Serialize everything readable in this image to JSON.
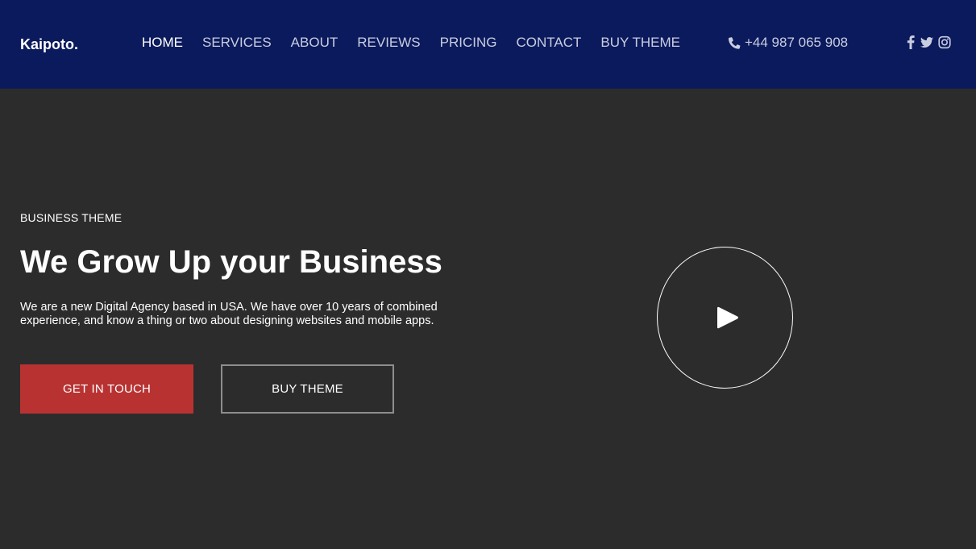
{
  "header": {
    "logo": "Kaipoto.",
    "nav": [
      {
        "label": "HOME",
        "active": true
      },
      {
        "label": "SERVICES"
      },
      {
        "label": "ABOUT"
      },
      {
        "label": "REVIEWS"
      },
      {
        "label": "PRICING"
      },
      {
        "label": "CONTACT"
      },
      {
        "label": "BUY THEME"
      }
    ],
    "phone": "+44 987 065 908",
    "phone_icon": "phone-icon",
    "socials": [
      "facebook-icon",
      "twitter-icon",
      "instagram-icon"
    ]
  },
  "hero": {
    "eyebrow": "BUSINESS THEME",
    "title": "We Grow Up your Business",
    "lead": "We are a new Digital Agency based in USA. We have over 10 years of combined experience, and know a thing or two about designing websites and mobile apps.",
    "primary_button": "GET IN TOUCH",
    "secondary_button": "BUY THEME",
    "play_icon": "play-icon"
  },
  "colors": {
    "header_bg": "#0b1a5c",
    "page_bg": "#2c2c2c",
    "accent": "#b83232"
  }
}
